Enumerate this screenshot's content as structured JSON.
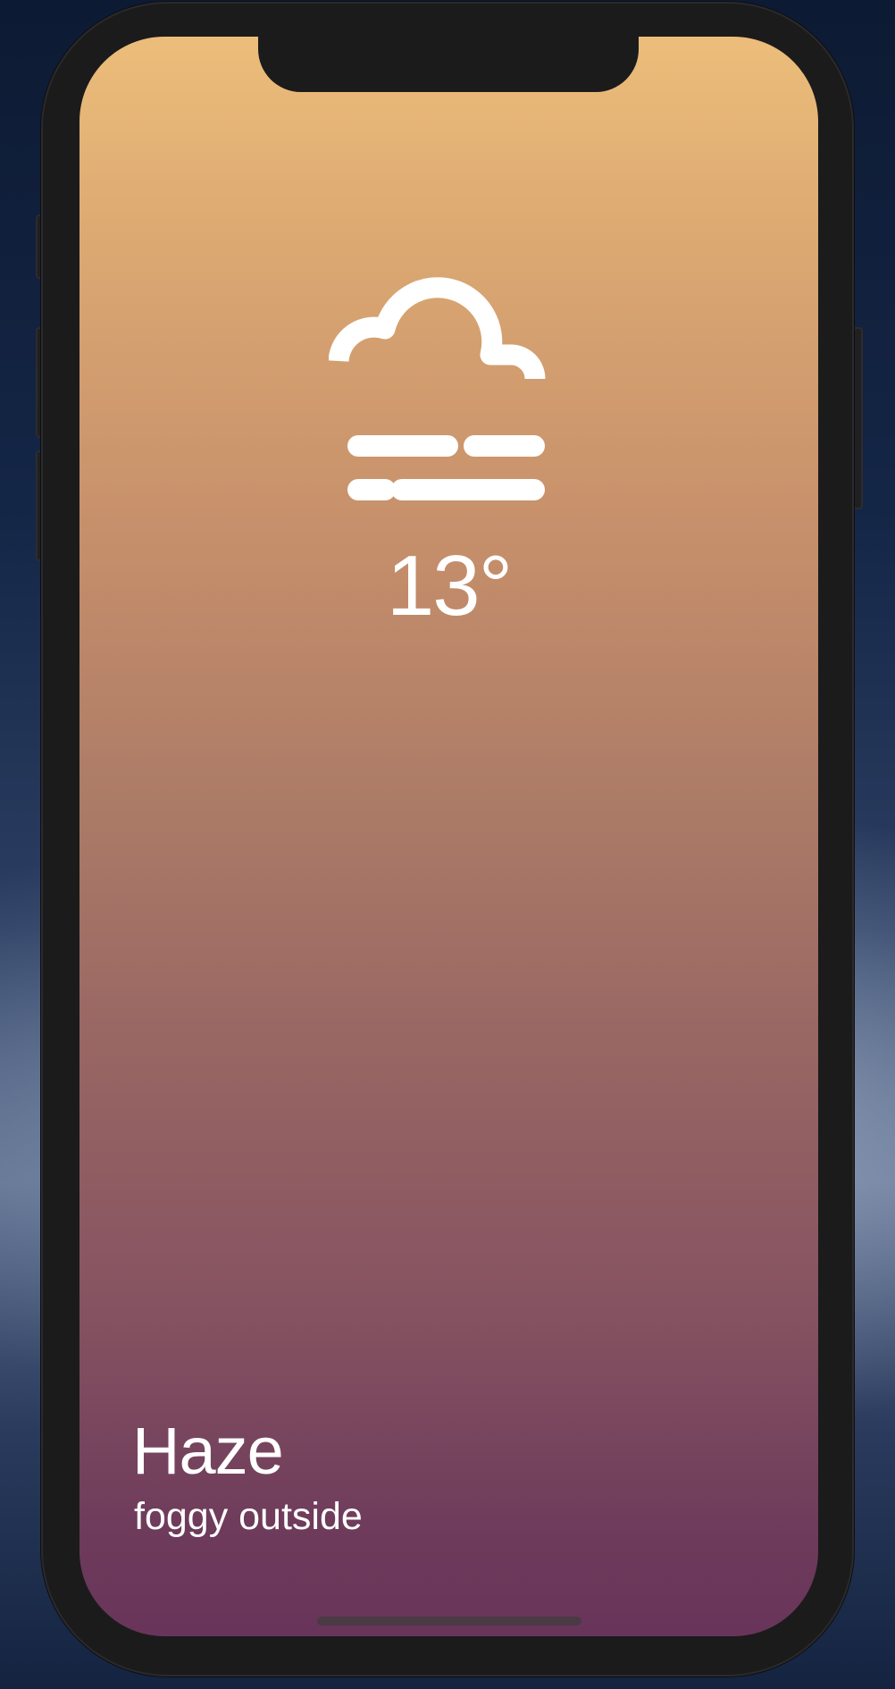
{
  "weather": {
    "icon": "fog-icon",
    "temperature": "13°",
    "condition": "Haze",
    "description": "foggy outside"
  },
  "colors": {
    "gradient_top": "#ecbd7a",
    "gradient_bottom": "#69345a",
    "text": "#ffffff",
    "device_frame": "#1b1b1c"
  }
}
